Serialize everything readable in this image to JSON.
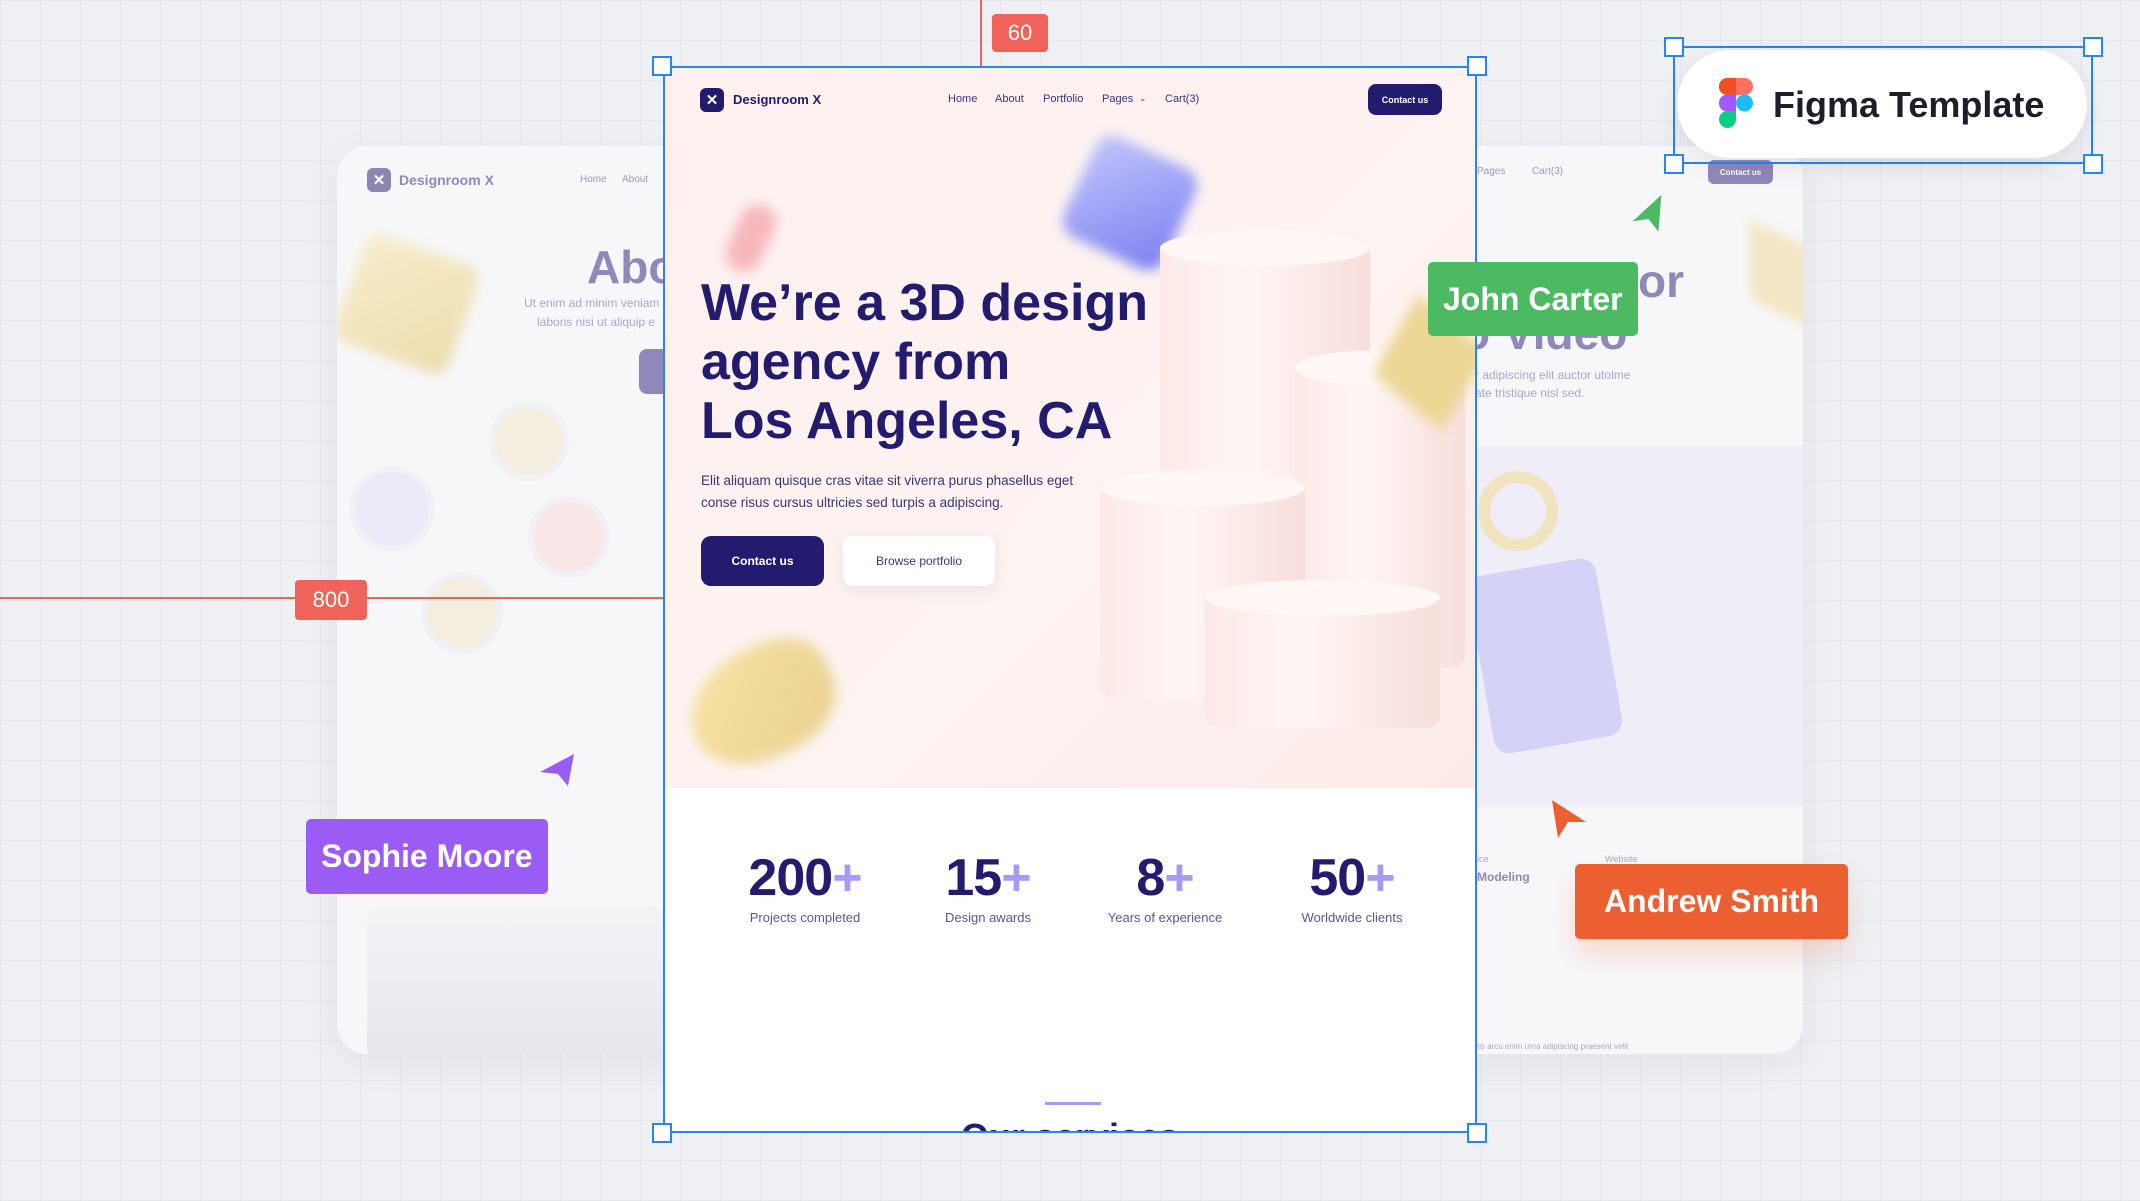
{
  "guides": {
    "top_value": "60",
    "left_value": "800",
    "color": "#f0635a"
  },
  "selection_color": "#2b83f0",
  "figma_badge": {
    "label": "Figma Template"
  },
  "left_card": {
    "brand": "Designroom X",
    "nav": [
      "Home",
      "About"
    ],
    "heading": "Abo",
    "text_lines": [
      "Ut enim ad minim veniam",
      "laboris nisi ut aliquip e"
    ]
  },
  "right_card": {
    "nav": [
      "Pages",
      "Cart(3)"
    ],
    "contact": "Contact us",
    "heading_lines": [
      "or",
      "o Video"
    ],
    "text_lines": [
      "r adipiscing elit auctor utolme",
      "ate tristique nisl sed."
    ],
    "meta": [
      {
        "label": "ice",
        "value": "Modeling"
      },
      {
        "label": "Website",
        "value": ""
      }
    ],
    "footer": "tis arcu enim urna adipiscing praesent velit"
  },
  "main": {
    "brand": "Designroom X",
    "nav": [
      "Home",
      "About",
      "Portfolio",
      "Pages",
      "Cart(3)"
    ],
    "nav_contact": "Contact us",
    "heading_lines": [
      "We’re a 3D design",
      "agency from",
      "Los Angeles, CA"
    ],
    "paragraph_lines": [
      "Elit aliquam quisque cras vitae sit viverra purus phasellus eget",
      "conse risus cursus ultricies sed turpis a adipiscing."
    ],
    "primary_button": "Contact us",
    "secondary_button": "Browse portfolio",
    "stats": [
      {
        "value": "200",
        "suffix": "+",
        "label": "Projects completed"
      },
      {
        "value": "15",
        "suffix": "+",
        "label": "Design awards"
      },
      {
        "value": "8",
        "suffix": "+",
        "label": "Years of experience"
      },
      {
        "value": "50",
        "suffix": "+",
        "label": "Worldwide clients"
      }
    ],
    "section_heading": "Our services"
  },
  "collaborators": [
    {
      "name": "John Carter",
      "color": "#4cb963"
    },
    {
      "name": "Sophie Moore",
      "color": "#9b5cf6"
    },
    {
      "name": "Andrew Smith",
      "color": "#ec5f30"
    }
  ]
}
